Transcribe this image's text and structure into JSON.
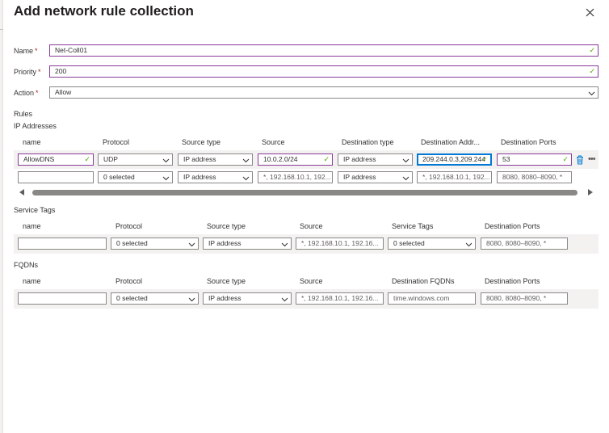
{
  "panel": {
    "title": "Add network rule collection"
  },
  "form": {
    "name": {
      "label": "Name",
      "required_mark": "*",
      "value": "Net-Coll01"
    },
    "priority": {
      "label": "Priority",
      "required_mark": "*",
      "value": "200"
    },
    "action": {
      "label": "Action",
      "required_mark": "*",
      "value": "Allow"
    }
  },
  "rules": {
    "title": "Rules",
    "ip_addresses": {
      "title": "IP Addresses",
      "columns": [
        "name",
        "Protocol",
        "Source type",
        "Source",
        "Destination type",
        "Destination Addr...",
        "Destination Ports"
      ],
      "row1": {
        "name": "AllowDNS",
        "protocol": "UDP",
        "source_type": "IP address",
        "source": "10.0.2.0/24",
        "destination_type": "IP address",
        "destination_address": "209.244.0.3,209.244",
        "destination_ports": "53"
      },
      "row2": {
        "name": "",
        "protocol": "0 selected",
        "source_type": "IP address",
        "source_placeholder": "*, 192.168.10.1, 192...",
        "destination_type": "IP address",
        "destination_address_placeholder": "*, 192.168.10.1, 192...",
        "destination_ports_placeholder": "8080, 8080–8090, *"
      }
    },
    "service_tags": {
      "title": "Service Tags",
      "columns": [
        "name",
        "Protocol",
        "Source type",
        "Source",
        "Service Tags",
        "Destination Ports"
      ],
      "row1": {
        "name": "",
        "protocol": "0 selected",
        "source_type": "IP address",
        "source_placeholder": "*, 192.168.10.1, 192.16...",
        "service_tags": "0 selected",
        "destination_ports_placeholder": "8080, 8080–8090, *"
      }
    },
    "fqdns": {
      "title": "FQDNs",
      "columns": [
        "name",
        "Protocol",
        "Source type",
        "Source",
        "Destination FQDNs",
        "Destination Ports"
      ],
      "row1": {
        "name": "",
        "protocol": "0 selected",
        "source_type": "IP address",
        "source_placeholder": "*, 192.168.10.1, 192.16...",
        "destination_fqdns_placeholder": "time.windows.com",
        "destination_ports_placeholder": "8080, 8080–8090, *"
      }
    }
  },
  "icons": {
    "close": "close-icon",
    "valid": "checkmark-icon",
    "dropdown": "chevron-down-icon",
    "delete": "trash-icon",
    "more": "more-icon"
  },
  "colors": {
    "accent": "#0078d4",
    "valid_border": "#8a3a9a",
    "check": "#57a300",
    "required": "#a4262c"
  }
}
